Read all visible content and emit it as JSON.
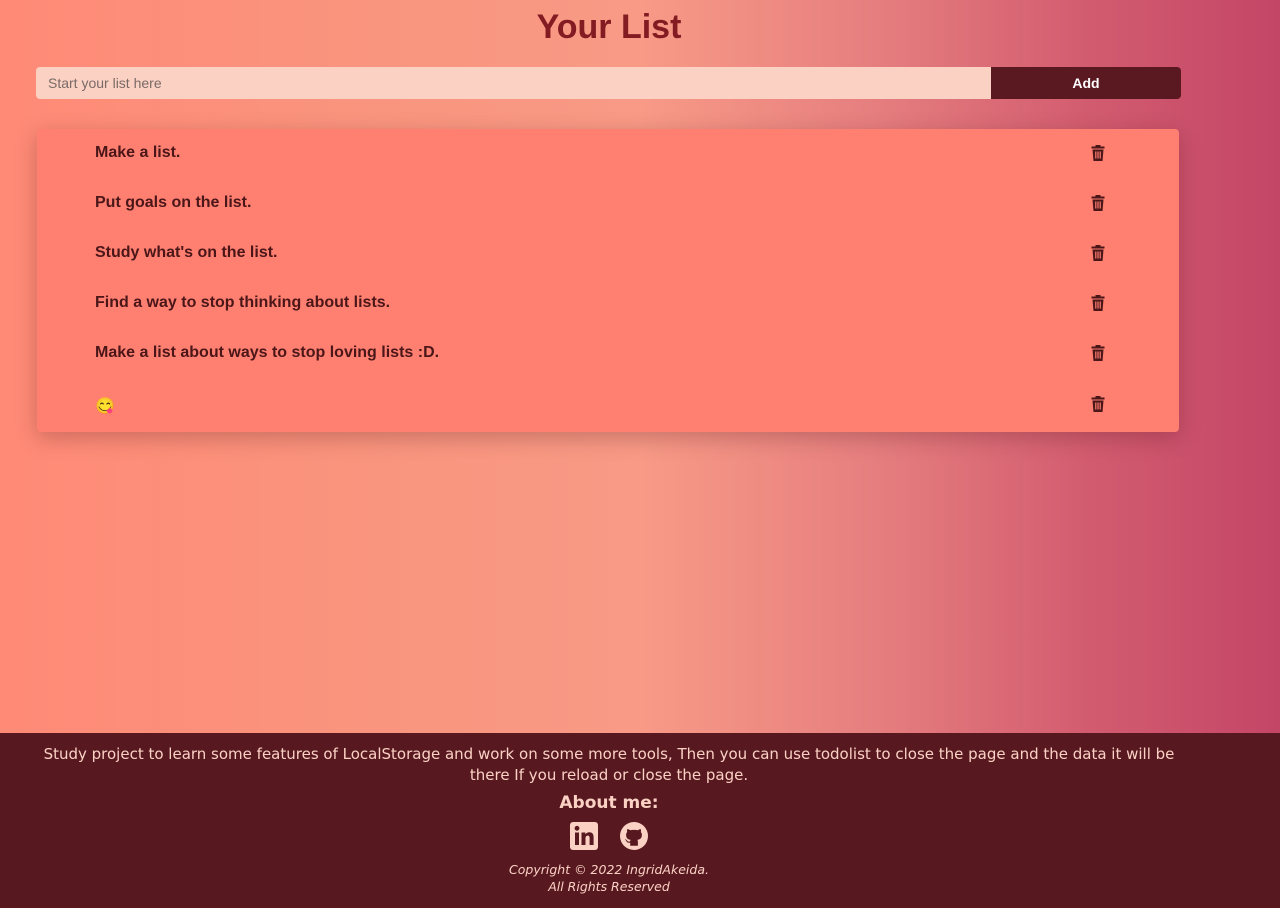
{
  "header": {
    "title": "Your List"
  },
  "form": {
    "placeholder": "Start your list here",
    "value": "",
    "add_label": "Add"
  },
  "list": {
    "items": [
      {
        "text": "Make a list."
      },
      {
        "text": "Put goals on the list."
      },
      {
        "text": "Study what's on the list."
      },
      {
        "text": "Find a way to stop thinking about lists."
      },
      {
        "text": "Make a list about ways to stop loving lists :D."
      },
      {
        "text": "😋"
      }
    ],
    "delete_icon": "trash-icon"
  },
  "footer": {
    "description": "Study project to learn some features of LocalStorage and work on some more tools, Then you can use todolist to close the page and the data it will be there If you reload or close the page.",
    "about_title": "About me:",
    "social_icons": [
      "linkedin-icon",
      "github-icon"
    ],
    "copyright_line1": "Copyright © 2022 IngridAkeida.",
    "copyright_line2": "All Rights Reserved"
  },
  "colors": {
    "title": "#821b22",
    "list_background": "#ff7f71",
    "button_background": "#5a1820",
    "input_background": "#fbd1c4",
    "footer_background": "#571820",
    "footer_text": "#fbd1c4",
    "item_text": "#4a1618"
  }
}
